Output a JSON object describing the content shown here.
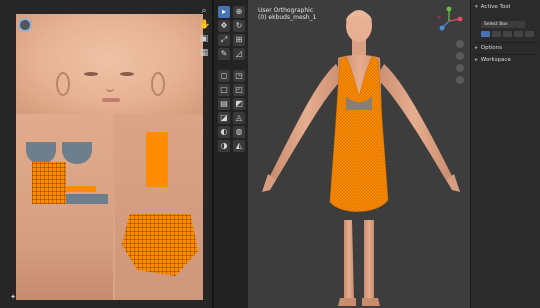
{
  "viewport": {
    "title": "User Orthographic",
    "subtitle": "(0) ekbuds_mesh_1"
  },
  "sidebar": {
    "active_tool_header": "Active Tool",
    "select_box_label": "Select Box",
    "options_header": "Options",
    "workspace_header": "Workspace"
  },
  "colors": {
    "background": "#1d1d1d",
    "viewport_bg": "#3d3d3d",
    "accent_active": "#4772b3",
    "dress_orange": "#ff8c00",
    "skin": "#e0a88b"
  },
  "icons": {
    "uv_tools": [
      "search-icon",
      "hand-icon",
      "camera-icon",
      "grid-icon"
    ],
    "tool_column": [
      "cursor-icon",
      "move-icon",
      "rotate-icon",
      "scale-icon",
      "transform-icon",
      "annotate-icon",
      "measure-icon",
      "add-cube-icon",
      "extrude-icon",
      "inset-icon",
      "bevel-icon",
      "loopcut-icon",
      "knife-icon",
      "polybuild-icon",
      "spin-icon",
      "smooth-icon",
      "edge-slide-icon",
      "shrink-icon",
      "shear-icon",
      "rip-icon"
    ],
    "viewport_nav": [
      "zoom-icon",
      "pan-icon",
      "camera-view-icon",
      "perspective-icon"
    ]
  }
}
